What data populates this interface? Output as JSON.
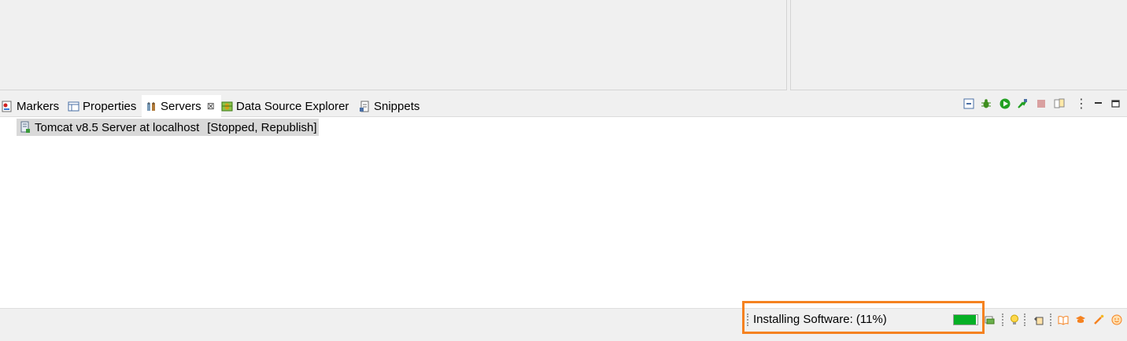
{
  "views": {
    "tabs": [
      {
        "label": "Markers",
        "icon": "markers-icon",
        "active": false
      },
      {
        "label": "Properties",
        "icon": "properties-icon",
        "active": false
      },
      {
        "label": "Servers",
        "icon": "servers-icon",
        "active": true,
        "closable": true
      },
      {
        "label": "Data Source Explorer",
        "icon": "data-source-explorer-icon",
        "active": false
      },
      {
        "label": "Snippets",
        "icon": "snippets-icon",
        "active": false
      }
    ],
    "close_glyph": "⊠"
  },
  "toolbar": {
    "icons": [
      "collapse-all-icon",
      "debug-server-icon",
      "start-server-icon",
      "profile-server-icon",
      "stop-server-icon",
      "publish-icon",
      "view-menu-icon",
      "minimize-icon",
      "maximize-icon"
    ],
    "view_menu_glyph": "⋮"
  },
  "servers": {
    "items": [
      {
        "name": "Tomcat v8.5 Server at localhost",
        "state": "[Stopped, Republish]",
        "icon": "server-icon"
      }
    ]
  },
  "status_bar": {
    "progress_label": "Installing Software: (11%)",
    "progress_percent": 11,
    "highlight_color": "#f58220",
    "progress_color": "#06b025",
    "icons": [
      "progress-view-icon",
      "tip-bulb-icon",
      "restore-icon",
      "book-icon",
      "graduation-cap-icon",
      "magic-wand-icon",
      "smiley-icon"
    ]
  }
}
